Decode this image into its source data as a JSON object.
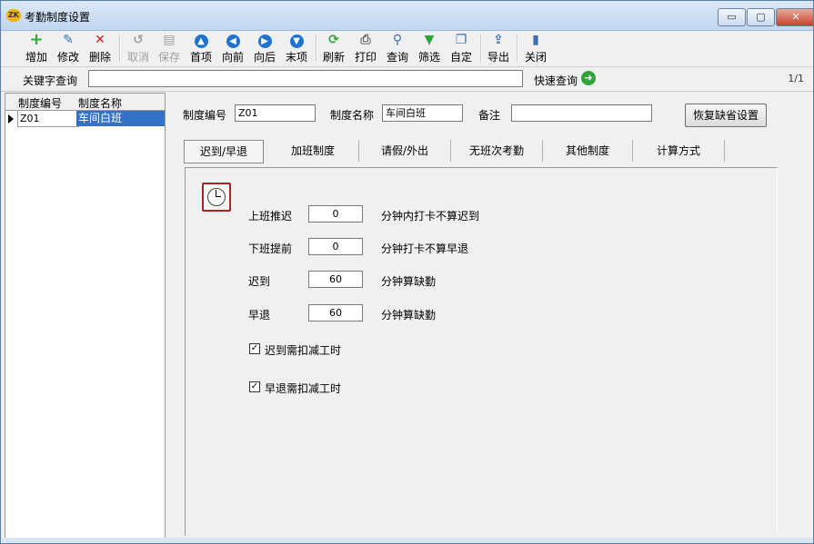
{
  "window": {
    "title": "考勤制度设置",
    "app_icon_text": "ZK",
    "minimize": "▭",
    "maximize": "▢",
    "close": "✕"
  },
  "toolbar": {
    "add": "增加",
    "edit": "修改",
    "delete": "删除",
    "cancel": "取消",
    "save": "保存",
    "first": "首项",
    "prev": "向前",
    "next": "向后",
    "last": "末项",
    "refresh": "刷新",
    "print": "打印",
    "query": "查询",
    "filter": "筛选",
    "custom": "自定",
    "export": "导出",
    "close": "关闭"
  },
  "search": {
    "label": "关键字查询",
    "value": "",
    "quick_label": "快速查询",
    "page": "1/1"
  },
  "list": {
    "headers": [
      "制度编号",
      "制度名称"
    ],
    "rows": [
      {
        "code": "Z01",
        "name": "车间白班"
      }
    ]
  },
  "form": {
    "code_label": "制度编号",
    "code_value": "Z01",
    "name_label": "制度名称",
    "name_value": "车间白班",
    "remark_label": "备注",
    "remark_value": "",
    "restore_button": "恢复缺省设置"
  },
  "tabs": [
    "迟到/早退",
    "加班制度",
    "请假/外出",
    "无班次考勤",
    "其他制度",
    "计算方式"
  ],
  "active_tab": 0,
  "late_early": {
    "late_delay_label": "上班推迟",
    "late_delay_value": "0",
    "late_delay_unit": "分钟内打卡不算迟到",
    "early_leave_label": "下班提前",
    "early_leave_value": "0",
    "early_leave_unit": "分钟打卡不算早退",
    "late_label": "迟到",
    "late_value": "60",
    "late_unit": "分钟算缺勤",
    "early_label": "早退",
    "early_value": "60",
    "early_unit": "分钟算缺勤",
    "late_deduct_label": "迟到需扣减工时",
    "late_deduct_checked": true,
    "early_deduct_label": "早退需扣减工时",
    "early_deduct_checked": true,
    "check_mark": "✓"
  },
  "colors": {
    "selection": "#3470c8",
    "accent_blue": "#1e73d2",
    "add_green": "#2fa53a",
    "delete_red": "#cc2222"
  }
}
